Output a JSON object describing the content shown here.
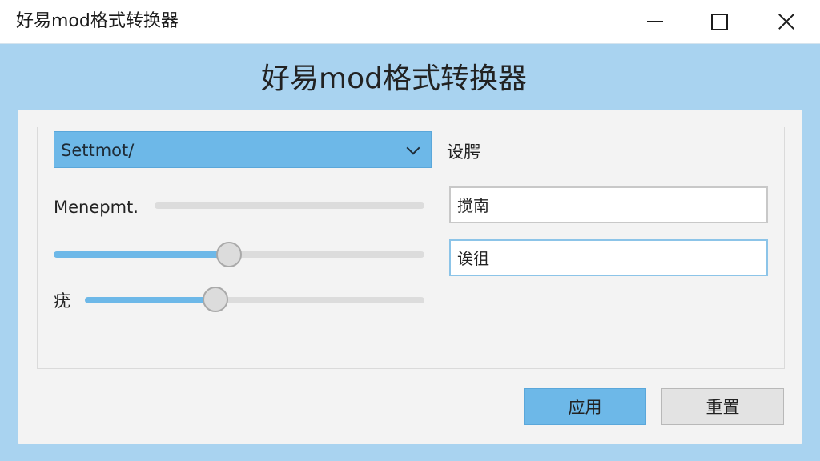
{
  "window": {
    "title": "好易mod格式转换器",
    "controls": {
      "minimize": "minimize-icon",
      "maximize": "maximize-icon",
      "close": "close-icon"
    }
  },
  "header": {
    "title": "好易mod格式转换器"
  },
  "settings": {
    "dropdown": {
      "selected": "Settmot/",
      "icon": "chevron-down-icon"
    },
    "side_label": "设腭",
    "slider1": {
      "label": "Menepmt.",
      "value": 0
    },
    "slider2": {
      "value": 0.47
    },
    "slider3": {
      "label": "疣",
      "value": 0.38
    },
    "field1": {
      "value": "搅南"
    },
    "field2": {
      "value": "诶徂"
    }
  },
  "footer": {
    "apply_label": "应用",
    "reset_label": "重置"
  },
  "colors": {
    "accent": "#6db8e8",
    "background": "#a9d3f0",
    "panel": "#f3f3f3"
  }
}
